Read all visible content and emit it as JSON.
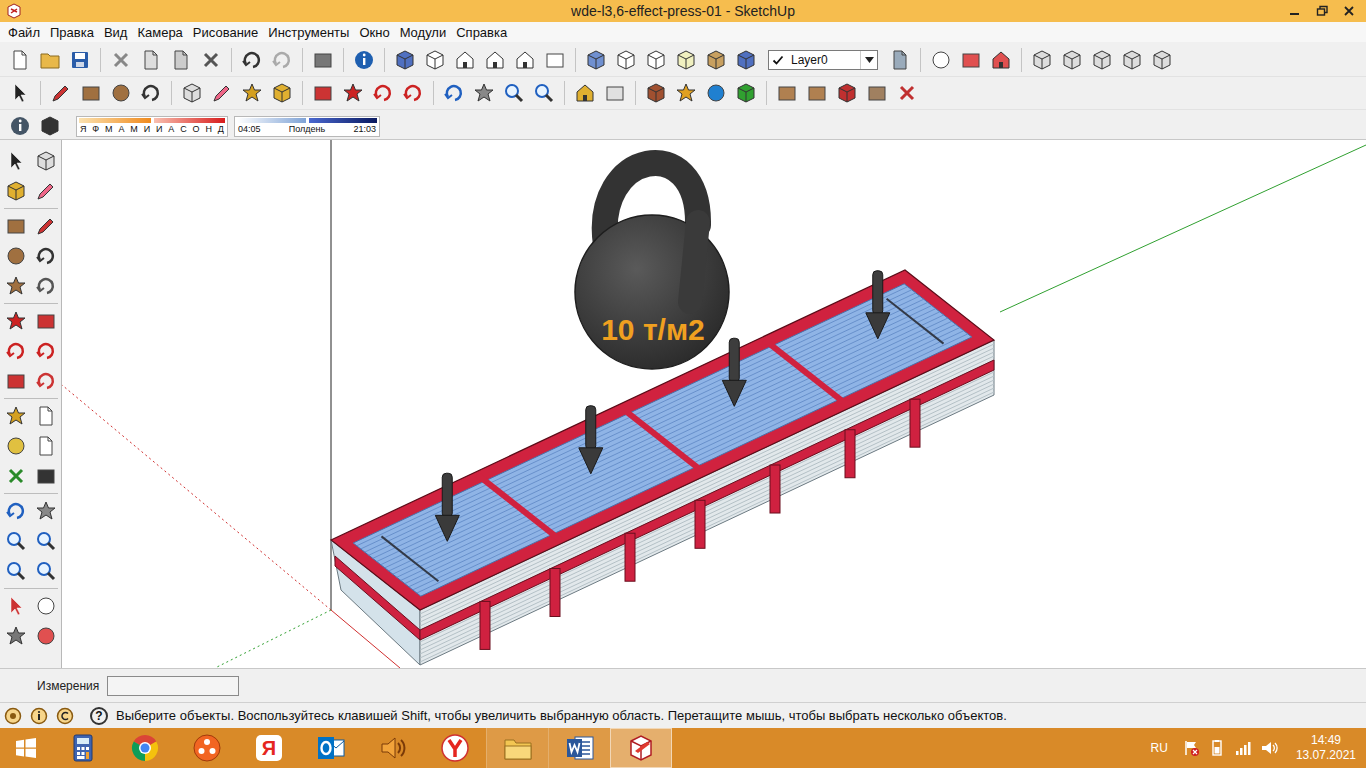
{
  "window": {
    "title": "wde-l3,6-effect-press-01 - SketchUp"
  },
  "menu": [
    "Файл",
    "Правка",
    "Вид",
    "Камера",
    "Рисование",
    "Инструменты",
    "Окно",
    "Модули",
    "Справка"
  ],
  "layer": {
    "name": "Layer0",
    "checked": true
  },
  "shadows": {
    "months": [
      "Я",
      "Ф",
      "М",
      "А",
      "М",
      "И",
      "И",
      "А",
      "С",
      "О",
      "Н",
      "Д"
    ],
    "start": "04:05",
    "noon": "Полдень",
    "end": "21:03"
  },
  "model": {
    "load_label": "10 т/м2"
  },
  "measurements": {
    "label": "Измерения",
    "value": ""
  },
  "status_bar": {
    "help_glyph": "?",
    "text": "Выберите объекты. Воспользуйтесь клавишей Shift, чтобы увеличить выбранную область. Перетащите мышь, чтобы выбрать несколько объектов."
  },
  "taskbar": {
    "apps": [
      {
        "kind": "calculator",
        "running": false,
        "selected": false
      },
      {
        "kind": "chrome",
        "running": false,
        "selected": false
      },
      {
        "kind": "orange-app",
        "running": false,
        "selected": false
      },
      {
        "kind": "yandex",
        "glyph": "Я",
        "running": false,
        "selected": false
      },
      {
        "kind": "outlook",
        "running": false,
        "selected": false
      },
      {
        "kind": "sound",
        "running": false,
        "selected": false
      },
      {
        "kind": "yandex-browser",
        "running": false,
        "selected": false
      },
      {
        "kind": "explorer",
        "running": true,
        "selected": false
      },
      {
        "kind": "word",
        "running": true,
        "selected": false
      },
      {
        "kind": "sketchup",
        "running": true,
        "selected": true
      }
    ],
    "language": "RU",
    "time": "14:49",
    "date": "13.07.2021"
  }
}
